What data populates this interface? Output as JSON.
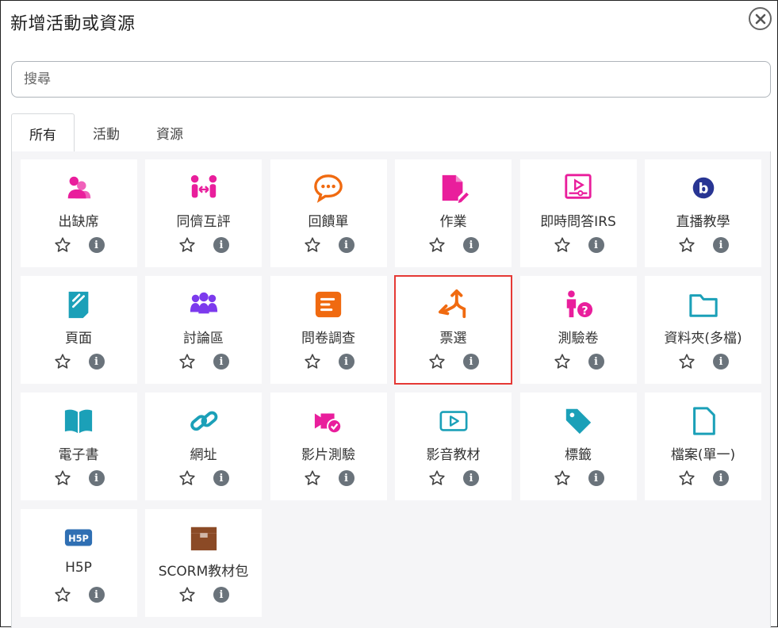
{
  "dialog": {
    "title": "新增活動或資源",
    "close_label": "×"
  },
  "search": {
    "placeholder": "搜尋",
    "value": ""
  },
  "tabs": [
    {
      "label": "所有",
      "active": true
    },
    {
      "label": "活動",
      "active": false
    },
    {
      "label": "資源",
      "active": false
    }
  ],
  "colors": {
    "pink": "#e91e9c",
    "orange": "#f06a10",
    "teal": "#1ba0b8",
    "purple": "#7c3aed",
    "selected_border": "#e53935",
    "info_icon": "#6a737b"
  },
  "items": [
    {
      "label": "出缺席",
      "icon": "attendance-icon",
      "color": "#e91e9c"
    },
    {
      "label": "同儕互評",
      "icon": "peer-review-icon",
      "color": "#e91e9c"
    },
    {
      "label": "回饋單",
      "icon": "feedback-icon",
      "color": "#f06a10"
    },
    {
      "label": "作業",
      "icon": "assignment-icon",
      "color": "#e91e9c"
    },
    {
      "label": "即時問答IRS",
      "icon": "irs-icon",
      "color": "#e91e9c"
    },
    {
      "label": "直播教學",
      "icon": "bigbluebutton-icon",
      "color": "#283593"
    },
    {
      "label": "頁面",
      "icon": "page-icon",
      "color": "#1ba0b8"
    },
    {
      "label": "討論區",
      "icon": "forum-icon",
      "color": "#7c3aed"
    },
    {
      "label": "問卷調查",
      "icon": "questionnaire-icon",
      "color": "#f06a10"
    },
    {
      "label": "票選",
      "icon": "choice-icon",
      "color": "#f06a10",
      "selected": true
    },
    {
      "label": "測驗卷",
      "icon": "quiz-icon",
      "color": "#e91e9c"
    },
    {
      "label": "資料夾(多檔)",
      "icon": "folder-icon",
      "color": "#1ba0b8"
    },
    {
      "label": "電子書",
      "icon": "book-icon",
      "color": "#1ba0b8"
    },
    {
      "label": "網址",
      "icon": "url-icon",
      "color": "#1ba0b8"
    },
    {
      "label": "影片測驗",
      "icon": "video-quiz-icon",
      "color": "#e91e9c"
    },
    {
      "label": "影音教材",
      "icon": "video-icon",
      "color": "#1ba0b8"
    },
    {
      "label": "標籤",
      "icon": "label-icon",
      "color": "#1ba0b8"
    },
    {
      "label": "檔案(單一)",
      "icon": "file-icon",
      "color": "#1ba0b8"
    },
    {
      "label": "H5P",
      "icon": "h5p-icon",
      "color": "#2f6fb3"
    },
    {
      "label": "SCORM教材包",
      "icon": "scorm-icon",
      "color": "#8b4a26"
    }
  ]
}
